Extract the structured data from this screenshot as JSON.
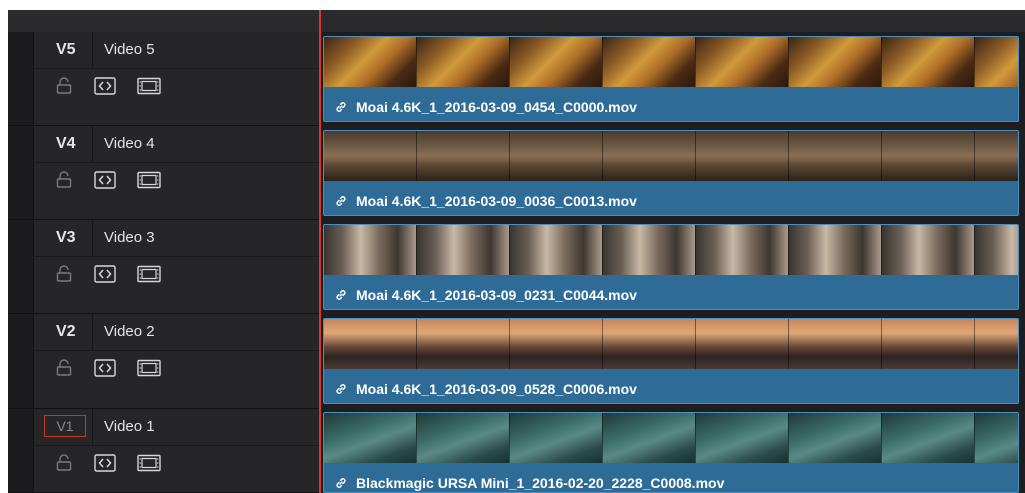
{
  "tracks": [
    {
      "id": "V5",
      "name": "Video 5",
      "active": true,
      "clip": {
        "filename": "Moai 4.6K_1_2016-03-09_0454_C0000.mov",
        "thumbnail": "desert-scene"
      }
    },
    {
      "id": "V4",
      "name": "Video 4",
      "active": true,
      "clip": {
        "filename": "Moai 4.6K_1_2016-03-09_0036_C0013.mov",
        "thumbnail": "crowd-scene"
      }
    },
    {
      "id": "V3",
      "name": "Video 3",
      "active": true,
      "clip": {
        "filename": "Moai 4.6K_1_2016-03-09_0231_C0044.mov",
        "thumbnail": "beach-people-scene"
      }
    },
    {
      "id": "V2",
      "name": "Video 2",
      "active": true,
      "clip": {
        "filename": "Moai 4.6K_1_2016-03-09_0528_C0006.mov",
        "thumbnail": "sunset-couple-scene"
      }
    },
    {
      "id": "V1",
      "name": "Video 1",
      "active": false,
      "clip": {
        "filename": "Blackmagic URSA Mini_1_2016-02-20_2228_C0008.mov",
        "thumbnail": "ocean-waves-scene"
      }
    }
  ],
  "icons": {
    "lock": "lock-icon",
    "auto_select": "auto-select-icon",
    "track_output": "film-strip-icon",
    "clip_link": "link-icon"
  },
  "colors": {
    "clip_fill": "#2e6c97",
    "clip_border": "#4a8fbf",
    "playhead": "#d23a2e",
    "destination_outline": "#c0392b"
  }
}
